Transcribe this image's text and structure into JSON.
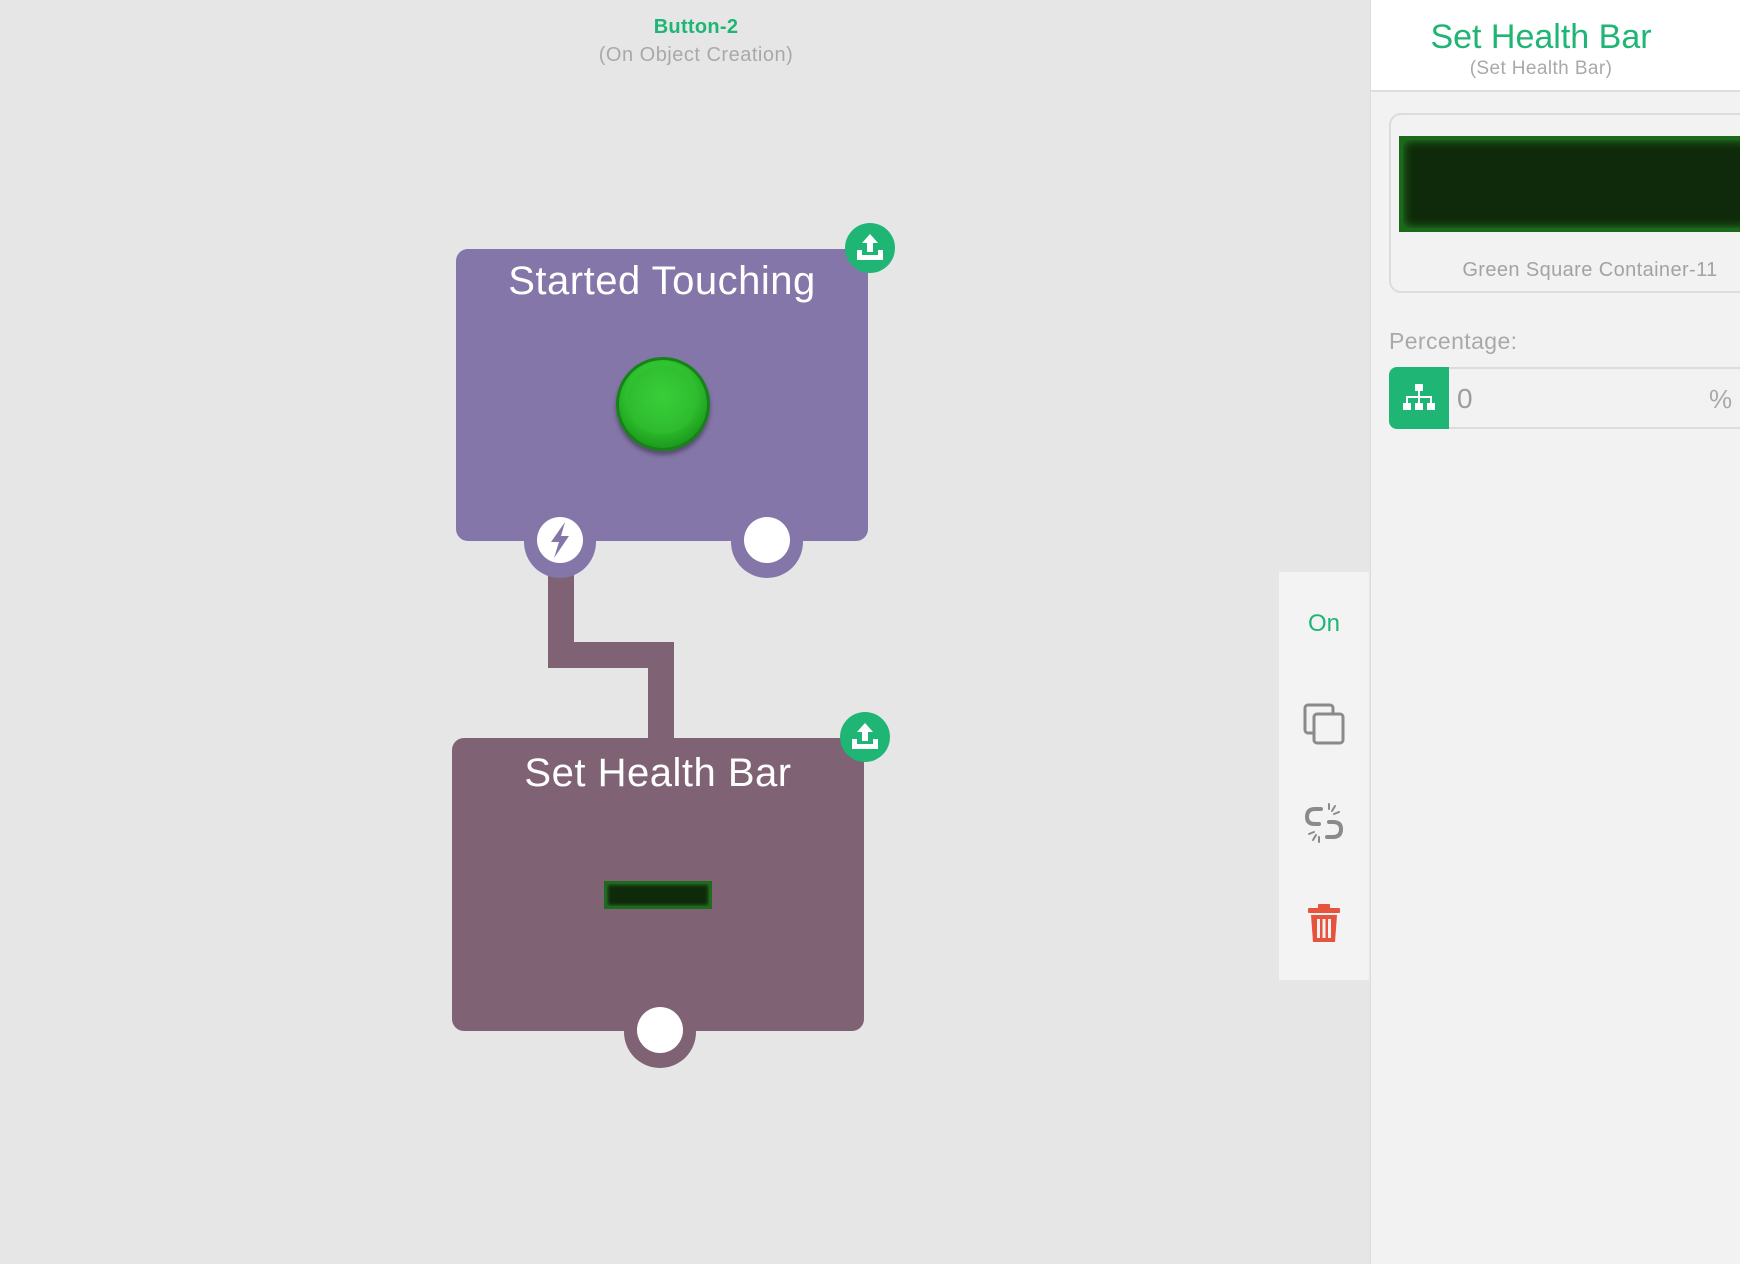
{
  "object": {
    "name": "Button-2",
    "event_context": "(On Object Creation)"
  },
  "blocks": {
    "trigger": {
      "title": "Started Touching",
      "preview": "green-round-button",
      "color": "#8476a8"
    },
    "action": {
      "title": "Set Health Bar",
      "preview": "health-bar",
      "color": "#7f6374"
    }
  },
  "toolbar": {
    "toggle_label": "On",
    "icons": [
      "duplicate-icon",
      "unlink-icon",
      "trash-icon"
    ]
  },
  "panel": {
    "title": "Set Health Bar",
    "subtitle": "(Set Health Bar)",
    "target_name": "Green Square Container-11",
    "percentage_label": "Percentage:",
    "percentage_value": "0",
    "percentage_unit": "%"
  },
  "colors": {
    "accent": "#1fb574",
    "danger": "#e8533d",
    "trigger_block": "#8476a8",
    "action_block": "#7f6374"
  }
}
